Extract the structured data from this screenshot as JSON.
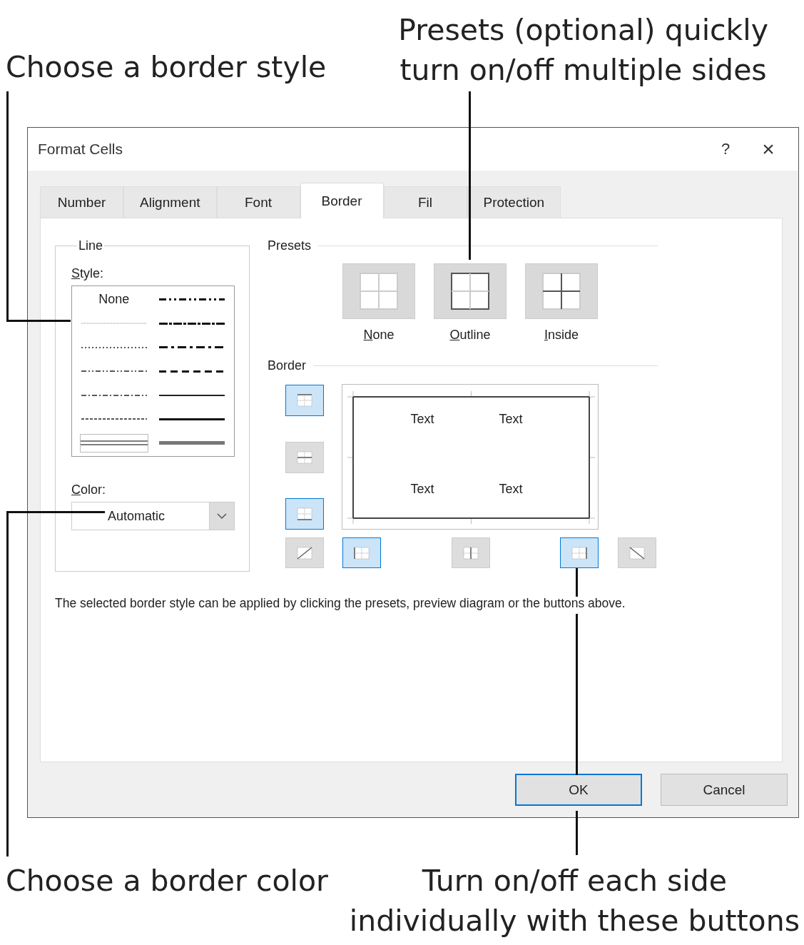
{
  "callout_border_style": {
    "text": "Choose a border style"
  },
  "callout_presets": {
    "text": "Presets (optional) quickly\nturn on/off multiple sides"
  },
  "dialog": {
    "title": "Format Cells",
    "help": "?",
    "close": "×",
    "tabs": [
      {
        "label": "Number",
        "selected": false
      },
      {
        "label": "Alignment",
        "selected": false
      },
      {
        "label": "Font",
        "selected": false
      },
      {
        "label": "Border",
        "selected": true
      },
      {
        "label": "Fil",
        "selected": false
      },
      {
        "label": "Protection",
        "selected": false
      }
    ],
    "line_group": {
      "title": "Line",
      "style_label": "Style:",
      "styles": [
        {
          "kind": "none",
          "label": "None"
        },
        {
          "kind": "medium-dash-dot-dot"
        },
        {
          "kind": "hair"
        },
        {
          "kind": "slanted-dash-dot"
        },
        {
          "kind": "dotted"
        },
        {
          "kind": "medium-dash-dot"
        },
        {
          "kind": "dash-dot-dot"
        },
        {
          "kind": "medium-dashed"
        },
        {
          "kind": "dash-dot"
        },
        {
          "kind": "thin"
        },
        {
          "kind": "dashed"
        },
        {
          "kind": "medium"
        },
        {
          "kind": "double"
        },
        {
          "kind": "thick"
        }
      ],
      "color_label": "Color:",
      "color_value": "Automatic"
    },
    "presets": {
      "title": "Presets",
      "items": [
        {
          "kind": "none",
          "label": "None"
        },
        {
          "kind": "outline",
          "label": "Outline"
        },
        {
          "kind": "inside",
          "label": "Inside"
        }
      ]
    },
    "border": {
      "title": "Border",
      "sides": [
        {
          "kind": "top",
          "selected": true
        },
        {
          "kind": "middle-horizontal",
          "selected": false
        },
        {
          "kind": "bottom",
          "selected": true
        },
        {
          "kind": "diagonal-up",
          "selected": false
        },
        {
          "kind": "left",
          "selected": true
        },
        {
          "kind": "middle-vertical",
          "selected": false
        },
        {
          "kind": "right",
          "selected": true
        },
        {
          "kind": "diagonal-down",
          "selected": false
        }
      ],
      "preview_texts": [
        "Text",
        "Text",
        "Text",
        "Text"
      ]
    },
    "hint": "The selected border style can be applied by clicking the presets, preview diagram or the buttons above.",
    "buttons": [
      {
        "label": "OK",
        "default": true
      },
      {
        "label": "Cancel",
        "default": false
      }
    ]
  },
  "callout_border_color": {
    "text": "Choose a border color"
  },
  "callout_side_buttons": {
    "text": "Turn on/off each side\nindividually with these buttons"
  }
}
